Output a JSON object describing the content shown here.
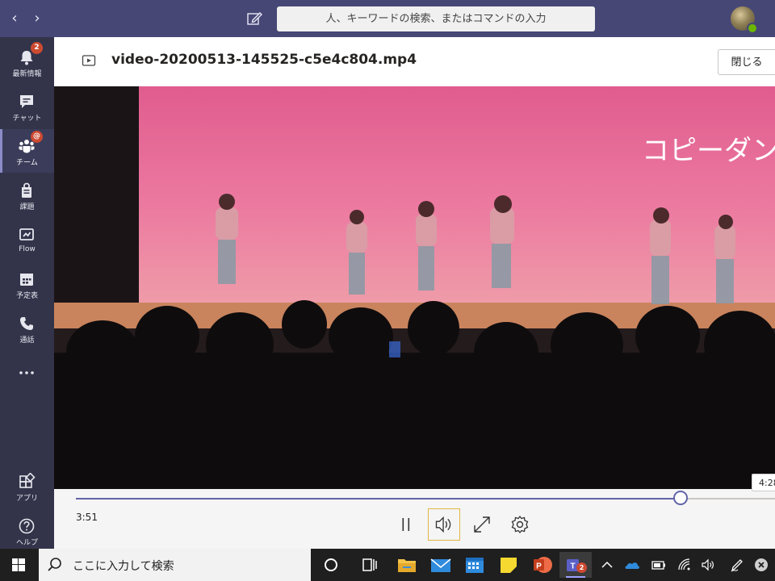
{
  "topbar": {
    "back_icon": "chevron-left-icon",
    "forward_icon": "chevron-right-icon",
    "compose_icon": "compose-icon",
    "search_placeholder": "人、キーワードの検索、またはコマンドの入力",
    "colors": {
      "bar": "#464775",
      "presence": "#6bb700"
    }
  },
  "rail": {
    "items": [
      {
        "label": "最新情報",
        "icon": "bell-icon",
        "badge": "2"
      },
      {
        "label": "チャット",
        "icon": "chat-icon"
      },
      {
        "label": "チーム",
        "icon": "teams-icon",
        "badge": "@",
        "active": true
      },
      {
        "label": "課題",
        "icon": "assignments-icon"
      },
      {
        "label": "Flow",
        "icon": "flow-icon"
      },
      {
        "label": "予定表",
        "icon": "calendar-icon"
      },
      {
        "label": "通話",
        "icon": "phone-icon"
      },
      {
        "label": "",
        "icon": "more-icon"
      },
      {
        "label": "アプリ",
        "icon": "apps-icon"
      },
      {
        "label": "ヘルプ",
        "icon": "help-icon"
      }
    ],
    "colors": {
      "bg": "#33344a",
      "badge": "#cc4a31"
    }
  },
  "viewer": {
    "file_icon": "video-file-icon",
    "filename": "video-20200513-145525-c5e4c804.mp4",
    "close_label": "閉じる"
  },
  "video_overlay_text": "コピーダンス",
  "player": {
    "current_time": "3:51",
    "hover_time": "4:28",
    "progress": 0.865,
    "buttons": [
      "pause-icon",
      "volume-icon",
      "fullscreen-icon",
      "settings-icon"
    ],
    "colors": {
      "accent": "#6264a7",
      "focus": "#e3b54a"
    }
  },
  "taskbar": {
    "search_text": "ここに入力して検索",
    "apps": [
      "cortana-icon",
      "task-view-icon",
      "file-explorer-icon",
      "mail-icon",
      "calendar-app-icon",
      "sticky-notes-icon",
      "powerpoint-icon",
      "teams-app-icon"
    ],
    "teams_badge": "2",
    "tray": [
      "chevron-up-icon",
      "onedrive-icon",
      "battery-icon",
      "wifi-icon",
      "speaker-icon",
      "pen-icon",
      "notification-close-icon"
    ]
  }
}
